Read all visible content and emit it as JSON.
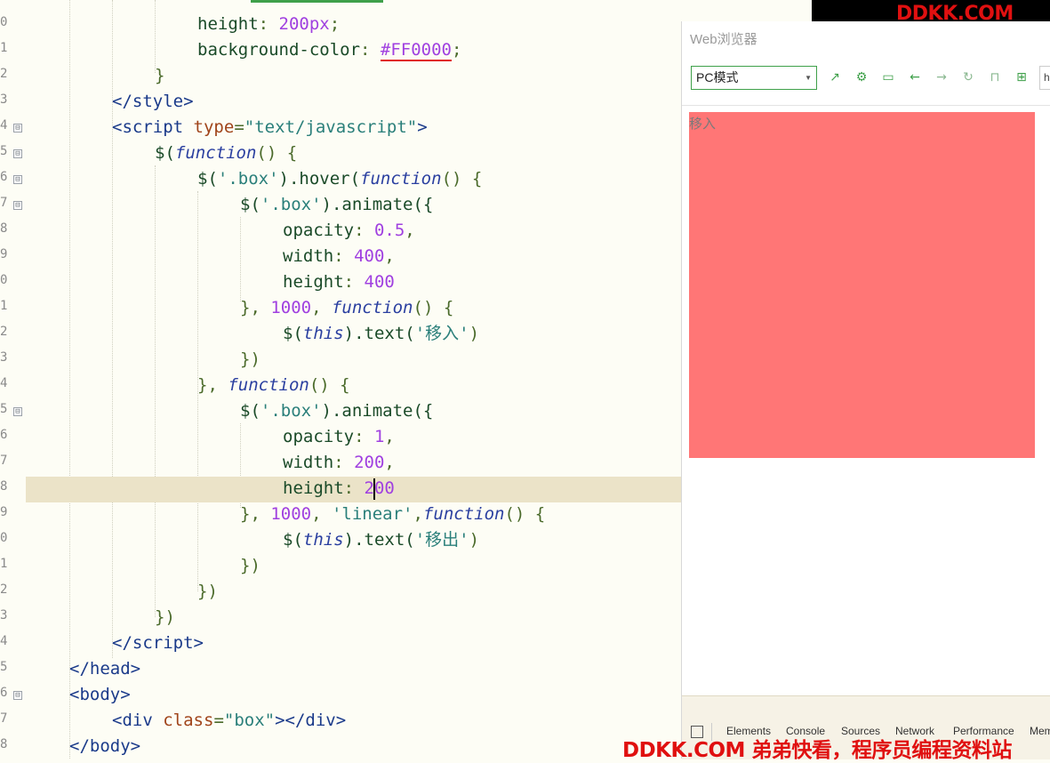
{
  "editor": {
    "line_numbers": [
      "0",
      "1",
      "2",
      "3",
      "4",
      "5",
      "6",
      "7",
      "8",
      "9",
      "0",
      "1",
      "2",
      "3",
      "4",
      "5",
      "6",
      "7",
      "8",
      "9",
      "0",
      "1",
      "2",
      "3",
      "4",
      "5",
      "6",
      "7",
      "8"
    ],
    "code": {
      "l0_a": "height",
      "l0_b": ": ",
      "l0_c": "200px",
      "l0_d": ";",
      "l1_a": "background-color",
      "l1_b": ": ",
      "l1_c": "#FF0000",
      "l1_d": ";",
      "l2": "}",
      "l3_a": "</",
      "l3_b": "style",
      "l3_c": ">",
      "l4_a": "<",
      "l4_b": "script",
      "l4_c": " ",
      "l4_d": "type",
      "l4_e": "=",
      "l4_f": "\"text/javascript\"",
      "l4_g": ">",
      "l5_a": "$(",
      "l5_b": "function",
      "l5_c": "() {",
      "l6_a": "$(",
      "l6_b": "'.box'",
      "l6_c": ").hover(",
      "l6_d": "function",
      "l6_e": "() {",
      "l7_a": "$(",
      "l7_b": "'.box'",
      "l7_c": ").animate({",
      "l8_a": "opacity",
      "l8_b": ": ",
      "l8_c": "0.5",
      "l8_d": ",",
      "l9_a": "width",
      "l9_b": ": ",
      "l9_c": "400",
      "l9_d": ",",
      "l10_a": "height",
      "l10_b": ": ",
      "l10_c": "400",
      "l11_a": "}, ",
      "l11_b": "1000",
      "l11_c": ", ",
      "l11_d": "function",
      "l11_e": "() {",
      "l12_a": "$(",
      "l12_b": "this",
      "l12_c": ").text(",
      "l12_d": "'移入'",
      "l12_e": ")",
      "l13": "})",
      "l14_a": "}, ",
      "l14_b": "function",
      "l14_c": "() {",
      "l15_a": "$(",
      "l15_b": "'.box'",
      "l15_c": ").animate({",
      "l16_a": "opacity",
      "l16_b": ": ",
      "l16_c": "1",
      "l16_d": ",",
      "l17_a": "width",
      "l17_b": ": ",
      "l17_c": "200",
      "l17_d": ",",
      "l18_a": "height",
      "l18_b": ": ",
      "l18_c": "2",
      "l18_d": "00",
      "l19_a": "}, ",
      "l19_b": "1000",
      "l19_c": ", ",
      "l19_d": "'linear'",
      "l19_e": ",",
      "l19_f": "function",
      "l19_g": "() {",
      "l20_a": "$(",
      "l20_b": "this",
      "l20_c": ").text(",
      "l20_d": "'移出'",
      "l20_e": ")",
      "l21": "})",
      "l22": "})",
      "l23": "})",
      "l24_a": "</",
      "l24_b": "script",
      "l24_c": ">",
      "l25_a": "</",
      "l25_b": "head",
      "l25_c": ">",
      "l26_a": "<",
      "l26_b": "body",
      "l26_c": ">",
      "l27_a": "<",
      "l27_b": "div",
      "l27_c": " ",
      "l27_d": "class",
      "l27_e": "=",
      "l27_f": "\"box\"",
      "l27_g": "></",
      "l27_h": "div",
      "l27_i": ">",
      "l28_a": "</",
      "l28_b": "body",
      "l28_c": ">"
    },
    "fold_marker": "⊟"
  },
  "browser": {
    "title": "Web浏览器",
    "mode_select": "PC模式",
    "address_partial": "h",
    "box_text": "移入",
    "box_color": "#ff7676",
    "devtools_tabs": [
      "Elements",
      "Console",
      "Sources",
      "Network",
      "Performance",
      "Mem"
    ]
  },
  "watermark": {
    "top": "DDKK.COM",
    "bottom": "DDKK.COM 弟弟快看，程序员编程资料站"
  },
  "colors": {
    "accent": "#3fa04a",
    "current_line": "#ebe3c8",
    "editor_bg": "#fdfdf5",
    "watermark": "#e01010"
  }
}
